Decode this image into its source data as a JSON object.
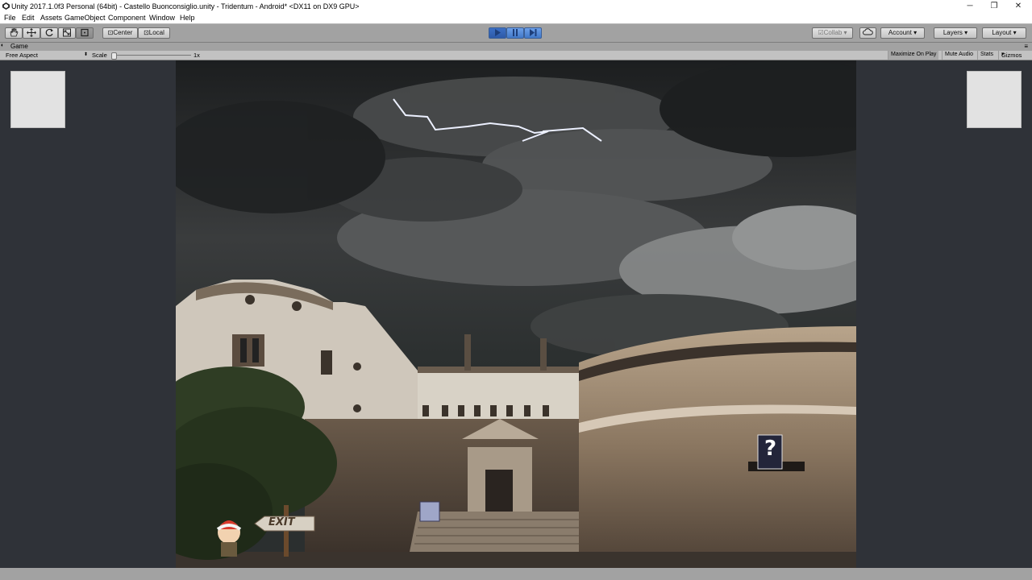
{
  "window": {
    "title": "Unity 2017.1.0f3 Personal (64bit) - Castello Buonconsiglio.unity - Tridentum - Android* <DX11 on DX9 GPU>",
    "minimize_glyph": "─",
    "restore_glyph": "❐",
    "close_glyph": "✕"
  },
  "menu": [
    "File",
    "Edit",
    "Assets",
    "GameObject",
    "Component",
    "Window",
    "Help"
  ],
  "toolbar": {
    "tools": [
      "hand-icon",
      "move-icon",
      "rotate-icon",
      "scale-icon",
      "rect-icon"
    ],
    "pivot_label": "Center",
    "space_label": "Local",
    "collab_label": "Collab",
    "account_label": "Account",
    "layers_label": "Layers",
    "layout_label": "Layout",
    "dropdown_glyph": "▾"
  },
  "game_tab": {
    "label": "Game",
    "aspect": "Free Aspect",
    "scale_label": "Scale",
    "scale_value": "1x",
    "scale_fraction": 0.0,
    "buttons": [
      "Maximize On Play",
      "Mute Audio",
      "Stats",
      "Gizmos"
    ]
  },
  "game": {
    "exit_label": "EXIT",
    "question_label": "?"
  },
  "colors": {
    "toolbar_bg": "#a2a2a2",
    "play_accent": "#4178c8",
    "game_bg": "#2f3238"
  }
}
